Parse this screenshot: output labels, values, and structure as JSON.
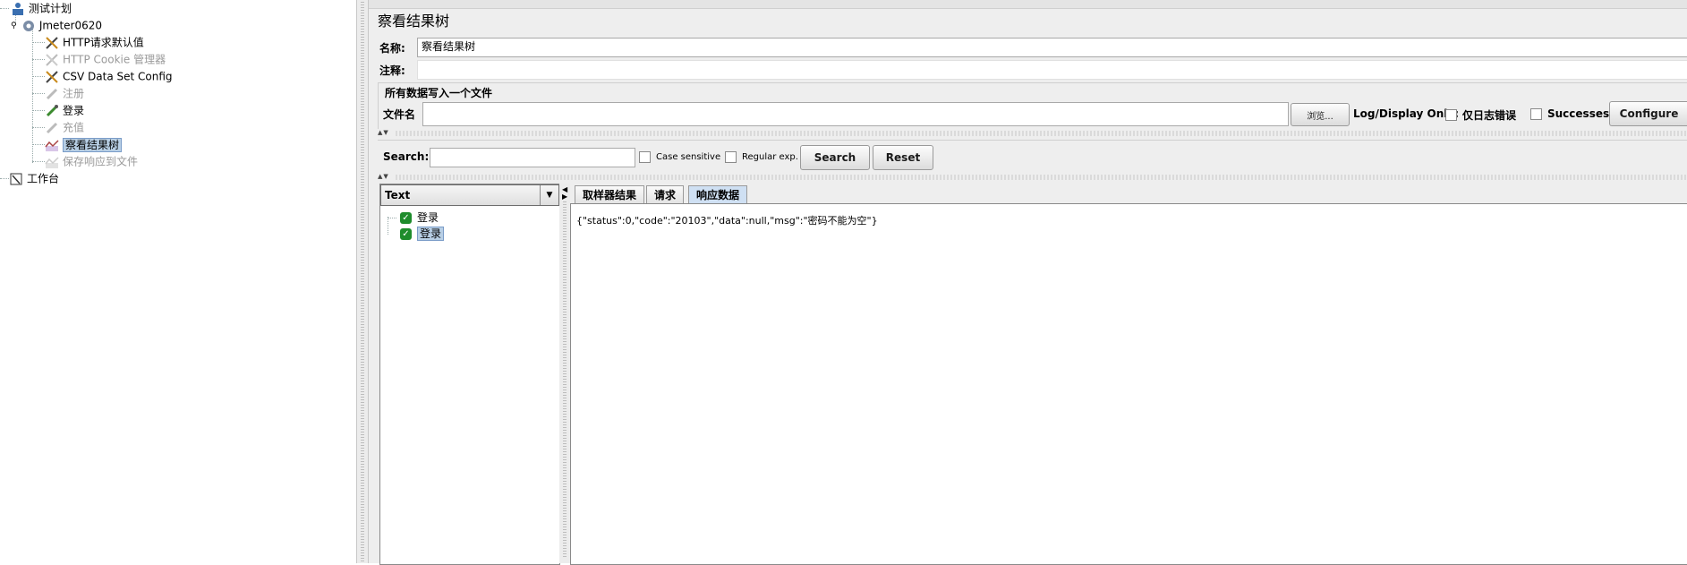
{
  "tree": {
    "root": "测试计划",
    "thread_group": "Jmeter0620",
    "children": [
      {
        "label": "HTTP请求默认值",
        "disabled": false,
        "icon": "wrench-icon"
      },
      {
        "label": "HTTP Cookie 管理器",
        "disabled": true,
        "icon": "wrench-icon"
      },
      {
        "label": "CSV Data Set Config",
        "disabled": false,
        "icon": "wrench-icon"
      },
      {
        "label": "注册",
        "disabled": true,
        "icon": "pipette-icon"
      },
      {
        "label": "登录",
        "disabled": false,
        "icon": "pipette-icon"
      },
      {
        "label": "充值",
        "disabled": true,
        "icon": "pipette-icon"
      },
      {
        "label": "察看结果树",
        "disabled": false,
        "icon": "chart-icon",
        "selected": true
      },
      {
        "label": "保存响应到文件",
        "disabled": true,
        "icon": "chart-icon"
      }
    ],
    "workbench": "工作台"
  },
  "panel": {
    "title": "察看结果树",
    "name_label": "名称:",
    "name_value": "察看结果树",
    "comment_label": "注释:",
    "comment_value": "",
    "file_group_title": "所有数据写入一个文件",
    "filename_label": "文件名",
    "filename_value": "",
    "browse_label": "浏览...",
    "log_display_label": "Log/Display Only:",
    "errors_only_label": "仅日志错误",
    "successes_label": "Successes",
    "configure_label": "Configure"
  },
  "search": {
    "label": "Search:",
    "value": "",
    "case_sensitive_label": "Case sensitive",
    "regex_label": "Regular exp.",
    "search_button": "Search",
    "reset_button": "Reset"
  },
  "results": {
    "renderer": "Text",
    "items": [
      {
        "label": "登录",
        "selected": false
      },
      {
        "label": "登录",
        "selected": true
      }
    ],
    "tabs": [
      "取样器结果",
      "请求",
      "响应数据"
    ],
    "active_tab": 2,
    "response_body": "{\"status\":0,\"code\":\"20103\",\"data\":null,\"msg\":\"密码不能为空\"}"
  }
}
